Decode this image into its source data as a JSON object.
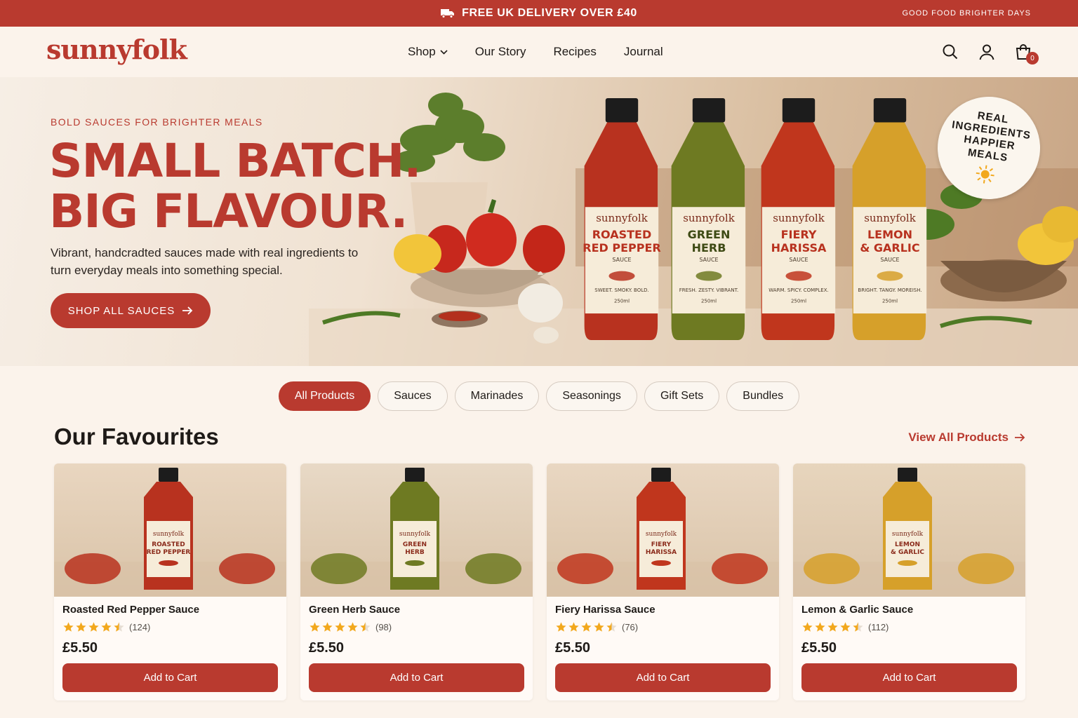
{
  "topbar": {
    "promo": "FREE UK DELIVERY OVER £40",
    "tagline": "GOOD FOOD  BRIGHTER DAYS"
  },
  "header": {
    "logo": "sunnyfolk",
    "nav": [
      {
        "label": "Shop",
        "has_dropdown": true
      },
      {
        "label": "Our Story"
      },
      {
        "label": "Recipes"
      },
      {
        "label": "Journal"
      }
    ],
    "icons": [
      "search-icon",
      "account-icon",
      "cart-icon"
    ],
    "cart_count": "0"
  },
  "hero": {
    "eyebrow": "BOLD SAUCES FOR BRIGHTER MEALS",
    "headline_line1": "SMALL BATCH.",
    "headline_line2": "BIG FLAVOUR.",
    "subtext": "Vibrant, handcradted sauces made with real ingredients to turn everyday meals into something special.",
    "cta": "SHOP ALL SAUCES",
    "seal_line1": "REAL",
    "seal_line2": "INGREDIENTS",
    "seal_line3": "HAPPIER",
    "seal_line4": "MEALS",
    "bottles": [
      {
        "brand": "sunnyfolk",
        "name1": "ROASTED",
        "name2": "RED PEPPER",
        "type": "SAUCE",
        "desc": "SWEET. SMOKY. BOLD.",
        "size": "250ml",
        "color": "#b8321f"
      },
      {
        "brand": "sunnyfolk",
        "name1": "GREEN",
        "name2": "HERB",
        "type": "SAUCE",
        "desc": "FRESH. ZESTY. VIBRANT.",
        "size": "250ml",
        "color": "#6e7a22"
      },
      {
        "brand": "sunnyfolk",
        "name1": "FIERY",
        "name2": "HARISSA",
        "type": "SAUCE",
        "desc": "WARM. SPICY. COMPLEX.",
        "size": "250ml",
        "color": "#c0361d"
      },
      {
        "brand": "sunnyfolk",
        "name1": "LEMON",
        "name2": "& GARLIC",
        "type": "SAUCE",
        "desc": "BRIGHT. TANGY. MOREISH.",
        "size": "250ml",
        "color": "#d6a02a"
      }
    ]
  },
  "filters": [
    "All Products",
    "Sauces",
    "Marinades",
    "Seasonings",
    "Gift Sets",
    "Bundles"
  ],
  "active_filter": "All Products",
  "section": {
    "title": "Our Favourites",
    "view_all": "View All Products"
  },
  "products": [
    {
      "name": "Roasted Red Pepper Sauce",
      "rating": 4.5,
      "reviews": "(124)",
      "price": "£5.50",
      "cta": "Add to Cart",
      "label1": "ROASTED",
      "label2": "RED PEPPER",
      "color": "#b8321f",
      "bg": "#e9d6c0"
    },
    {
      "name": "Green Herb Sauce",
      "rating": 4.5,
      "reviews": "(98)",
      "price": "£5.50",
      "cta": "Add to Cart",
      "label1": "GREEN",
      "label2": "HERB",
      "color": "#6e7a22",
      "bg": "#e8d9c6"
    },
    {
      "name": "Fiery Harissa Sauce",
      "rating": 4.5,
      "reviews": "(76)",
      "price": "£5.50",
      "cta": "Add to Cart",
      "label1": "FIERY",
      "label2": "HARISSA",
      "color": "#c0361d",
      "bg": "#e9d7c2"
    },
    {
      "name": "Lemon & Garlic Sauce",
      "rating": 4.5,
      "reviews": "(112)",
      "price": "£5.50",
      "cta": "Add to Cart",
      "label1": "LEMON",
      "label2": "& GARLIC",
      "color": "#d6a02a",
      "bg": "#e7d5bd"
    }
  ],
  "colors": {
    "brand_red": "#b93a2f",
    "background": "#fbf3eb",
    "star": "#f2a81d"
  }
}
